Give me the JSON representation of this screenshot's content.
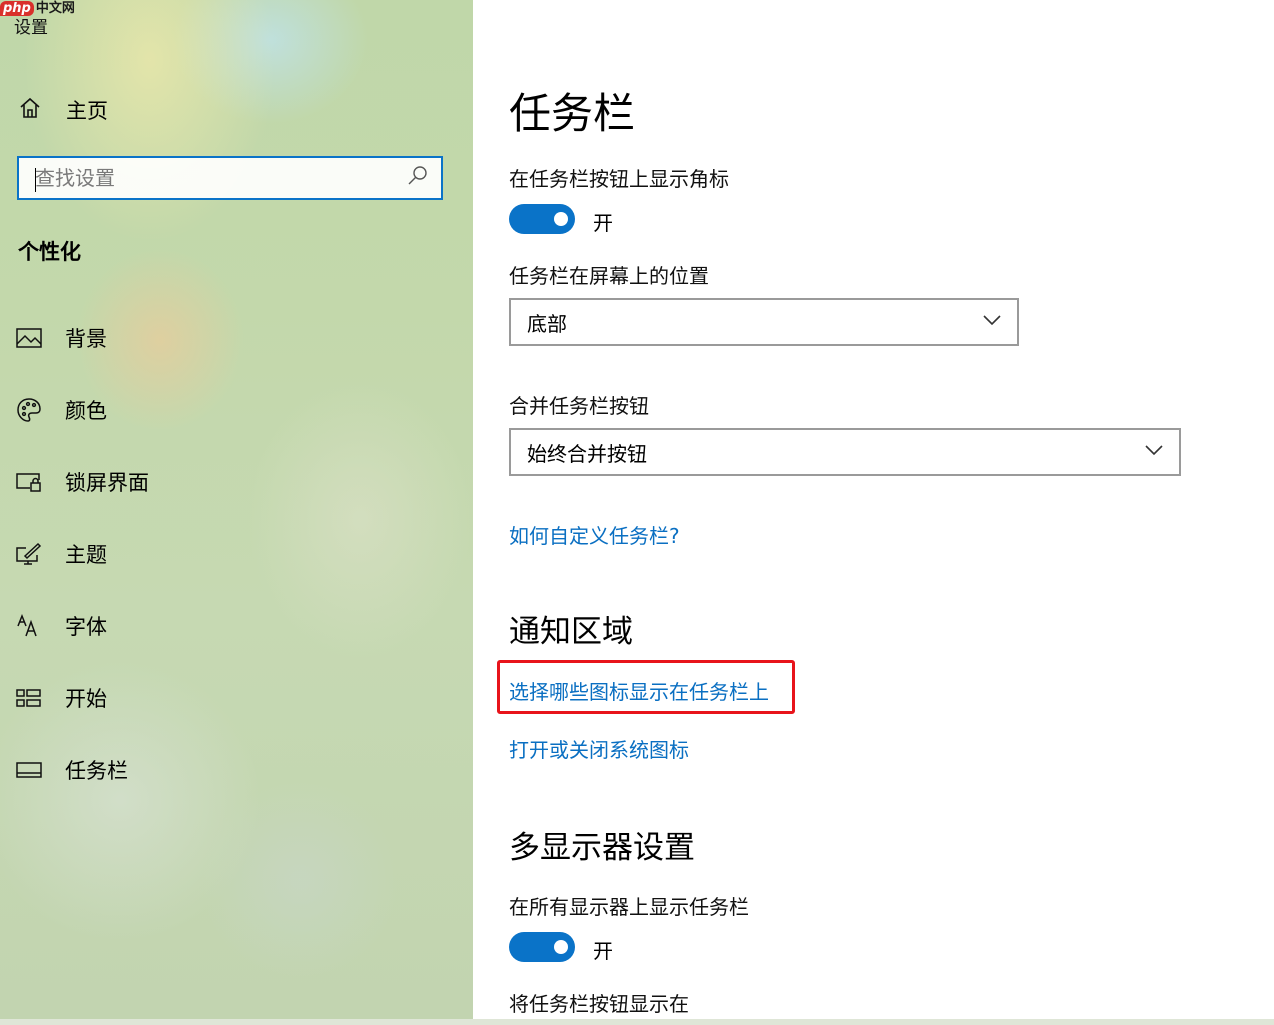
{
  "window": {
    "title": "设置",
    "watermark_logo": "php",
    "watermark_text": "中文网"
  },
  "sidebar": {
    "home_label": "主页",
    "search_placeholder": "查找设置",
    "section_heading": "个性化",
    "items": [
      {
        "label": "背景",
        "icon": "picture-icon"
      },
      {
        "label": "颜色",
        "icon": "palette-icon"
      },
      {
        "label": "锁屏界面",
        "icon": "lock-screen-icon"
      },
      {
        "label": "主题",
        "icon": "theme-brush-icon"
      },
      {
        "label": "字体",
        "icon": "font-icon"
      },
      {
        "label": "开始",
        "icon": "start-grid-icon"
      },
      {
        "label": "任务栏",
        "icon": "taskbar-icon"
      }
    ]
  },
  "main": {
    "title": "任务栏",
    "badges_label": "在任务栏按钮上显示角标",
    "badges_toggle": "开",
    "location_label": "任务栏在屏幕上的位置",
    "location_value": "底部",
    "combine_label": "合并任务栏按钮",
    "combine_value": "始终合并按钮",
    "customize_link": "如何自定义任务栏?",
    "notification_title": "通知区域",
    "select_icons_link": "选择哪些图标显示在任务栏上",
    "system_icons_link": "打开或关闭系统图标",
    "multi_display_title": "多显示器设置",
    "show_all_label": "在所有显示器上显示任务栏",
    "show_all_toggle": "开",
    "show_buttons_label": "将任务栏按钮显示在"
  },
  "colors": {
    "accent": "#0a73c8",
    "link": "#0a6fc2",
    "highlight": "#e8141b"
  }
}
